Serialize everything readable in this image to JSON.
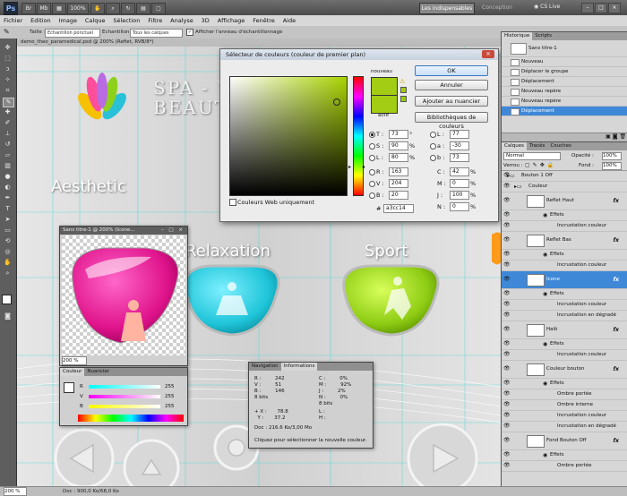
{
  "app": {
    "logo": "Ps",
    "workspace_active": "Les indispensables",
    "workspace_other": "Conception",
    "cslive": "CS Live",
    "zoom_badge": "100%",
    "window_buttons": [
      "–",
      "□",
      "×"
    ]
  },
  "menu": [
    "Fichier",
    "Edition",
    "Image",
    "Calque",
    "Sélection",
    "Filtre",
    "Analyse",
    "3D",
    "Affichage",
    "Fenêtre",
    "Aide"
  ],
  "options": {
    "size_label": "Taille :",
    "size_value": "Echantillon ponctuel",
    "sample_label": "Echantillon :",
    "sample_value": "Tous les calques",
    "ring_label": "Afficher l'anneau d'échantillonnage"
  },
  "document": {
    "tab_title": "demo_theo_paramedical.psd @ 200% (Refiet, RVB/8*)",
    "brand_line1": "SPA - W",
    "brand_line2": "BEAUTY",
    "label_aesthetic": "Aesthetic",
    "label_relaxation": "Relaxation",
    "label_sport": "Sport"
  },
  "color_picker": {
    "title": "Sélecteur de couleurs (couleur de premier plan)",
    "new_label": "nouveau",
    "current_label": "actif",
    "new_color": "#a3cc14",
    "current_color": "#a3cc14",
    "buttons": {
      "ok": "OK",
      "cancel": "Annuler",
      "add_swatch": "Ajouter au nuancier",
      "libraries": "Bibliothèques de couleurs"
    },
    "fields": [
      {
        "label": "T :",
        "value": "73",
        "unit": "°"
      },
      {
        "label": "S :",
        "value": "90",
        "unit": "%"
      },
      {
        "label": "L :",
        "value": "80",
        "unit": "%"
      },
      {
        "label": "R :",
        "value": "163",
        "unit": ""
      },
      {
        "label": "V :",
        "value": "204",
        "unit": ""
      },
      {
        "label": "B :",
        "value": "20",
        "unit": ""
      }
    ],
    "lab_fields": [
      {
        "label": "L :",
        "value": "77"
      },
      {
        "label": "a :",
        "value": "-30"
      },
      {
        "label": "b :",
        "value": "73"
      }
    ],
    "cmyk_fields": [
      {
        "label": "C :",
        "value": "42",
        "unit": "%"
      },
      {
        "label": "M :",
        "value": "0",
        "unit": "%"
      },
      {
        "label": "J :",
        "value": "100",
        "unit": "%"
      },
      {
        "label": "N :",
        "value": "0",
        "unit": "%"
      }
    ],
    "hex_label": "#",
    "hex_value": "a3cc14",
    "web_only": "Couleurs Web uniquement"
  },
  "history_panel": {
    "tabs": [
      "Historique",
      "Scripts"
    ],
    "snapshot": "Sans titre-1",
    "items": [
      "Nouveau",
      "Déplacer le groupe",
      "Déplacement",
      "Nouveau repère",
      "Nouveau repère",
      "Déplacement"
    ]
  },
  "layers_panel": {
    "tabs": [
      "Calques",
      "Tracés",
      "Couches"
    ],
    "blend_mode": "Normal",
    "opacity_label": "Opacité :",
    "opacity_value": "100%",
    "lock_label": "Verrou :",
    "fill_label": "Fond :",
    "fill_value": "100%",
    "rows": [
      {
        "label": "Bouton 1 Off",
        "kind": "group"
      },
      {
        "label": "Couleur",
        "kind": "group"
      },
      {
        "label": "Reflet Haut",
        "kind": "layer",
        "fx": true
      },
      {
        "label": "Effets",
        "kind": "effects"
      },
      {
        "label": "Incrustation couleur",
        "kind": "effect"
      },
      {
        "label": "Reflet Bas",
        "kind": "layer",
        "fx": true
      },
      {
        "label": "Effets",
        "kind": "effects"
      },
      {
        "label": "Incrustation couleur",
        "kind": "effect"
      },
      {
        "label": "Icone",
        "kind": "layer",
        "fx": true,
        "selected": true
      },
      {
        "label": "Effets",
        "kind": "effects"
      },
      {
        "label": "Incrustation couleur",
        "kind": "effect"
      },
      {
        "label": "Incrustation en dégradé",
        "kind": "effect"
      },
      {
        "label": "Halô",
        "kind": "layer",
        "fx": true
      },
      {
        "label": "Effets",
        "kind": "effects"
      },
      {
        "label": "Incrustation couleur",
        "kind": "effect"
      },
      {
        "label": "Couleur bouton",
        "kind": "layer",
        "fx": true
      },
      {
        "label": "Effets",
        "kind": "effects"
      },
      {
        "label": "Ombre portée",
        "kind": "effect"
      },
      {
        "label": "Ombre interne",
        "kind": "effect"
      },
      {
        "label": "Incrustation couleur",
        "kind": "effect"
      },
      {
        "label": "Incrustation en dégradé",
        "kind": "effect"
      },
      {
        "label": "Fond Bouton Off",
        "kind": "layer",
        "fx": true
      },
      {
        "label": "Effets",
        "kind": "effects"
      },
      {
        "label": "Ombre portée",
        "kind": "effect"
      }
    ]
  },
  "preview_window": {
    "title": "Sans titre-1 @ 200% (Icone...",
    "zoom": "200 %"
  },
  "color_panel": {
    "tabs": [
      "Couleur",
      "Nuancier"
    ],
    "channels": [
      {
        "label": "R",
        "value": "255"
      },
      {
        "label": "V",
        "value": "255"
      },
      {
        "label": "B",
        "value": "255"
      }
    ]
  },
  "info_panel": {
    "tabs": [
      "Navigation",
      "Informations"
    ],
    "rgb": {
      "r": "242",
      "v": "51",
      "b": "146"
    },
    "cmyk": {
      "c": "0%",
      "m": "92%",
      "j": "2%",
      "n": "0%"
    },
    "bits": "8 bits",
    "bits2": "8 bits",
    "x": "78.8",
    "y": "37.2",
    "w": "",
    "h": "",
    "doc": "Doc : 216.6 Ko/3,00 Mo",
    "hint": "Cliquez pour sélectionner la nouvelle couleur."
  },
  "status": {
    "zoom": "200 %",
    "doc": "Doc : 900,0 Ko/68,0 Ko"
  }
}
